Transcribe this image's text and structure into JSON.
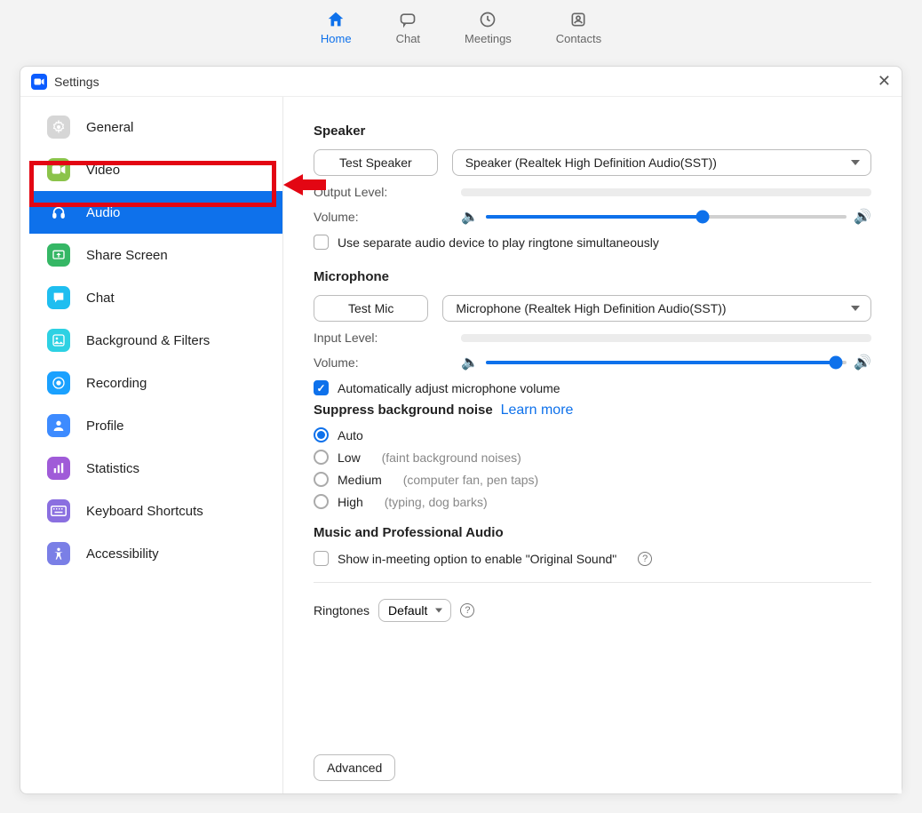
{
  "topnav": {
    "home": "Home",
    "chat": "Chat",
    "meetings": "Meetings",
    "contacts": "Contacts"
  },
  "window": {
    "title": "Settings"
  },
  "sidebar": {
    "items": [
      {
        "label": "General",
        "icon": "gear",
        "bg": "#d6d6d6"
      },
      {
        "label": "Video",
        "icon": "video",
        "bg": "#8bc34a"
      },
      {
        "label": "Audio",
        "icon": "headphones",
        "bg": "#0e71eb",
        "active": true
      },
      {
        "label": "Share Screen",
        "icon": "share",
        "bg": "#35b765"
      },
      {
        "label": "Chat",
        "icon": "chat",
        "bg": "#1fbef0"
      },
      {
        "label": "Background & Filters",
        "icon": "bg",
        "bg": "#2dd1e3"
      },
      {
        "label": "Recording",
        "icon": "rec",
        "bg": "#1aa1ff"
      },
      {
        "label": "Profile",
        "icon": "profile",
        "bg": "#3d8bff"
      },
      {
        "label": "Statistics",
        "icon": "stats",
        "bg": "#a05bd8"
      },
      {
        "label": "Keyboard Shortcuts",
        "icon": "kbd",
        "bg": "#8a6fe0"
      },
      {
        "label": "Accessibility",
        "icon": "a11y",
        "bg": "#7a7fe6"
      }
    ]
  },
  "audio": {
    "speaker_h": "Speaker",
    "test_speaker": "Test Speaker",
    "speaker_device": "Speaker (Realtek High Definition Audio(SST))",
    "output_level": "Output Level:",
    "volume": "Volume:",
    "speaker_vol_pct": 60,
    "separate_device": "Use separate audio device to play ringtone simultaneously",
    "mic_h": "Microphone",
    "test_mic": "Test Mic",
    "mic_device": "Microphone (Realtek High Definition Audio(SST))",
    "input_level": "Input Level:",
    "mic_vol_pct": 97,
    "auto_adjust": "Automatically adjust microphone volume",
    "suppress_h": "Suppress background noise",
    "learn_more": "Learn more",
    "options": [
      {
        "label": "Auto",
        "hint": "",
        "selected": true
      },
      {
        "label": "Low",
        "hint": "(faint background noises)"
      },
      {
        "label": "Medium",
        "hint": "(computer fan, pen taps)"
      },
      {
        "label": "High",
        "hint": "(typing, dog barks)"
      }
    ],
    "music_h": "Music and Professional Audio",
    "original_sound": "Show in-meeting option to enable \"Original Sound\"",
    "ringtones_lbl": "Ringtones",
    "ringtones_val": "Default",
    "advanced": "Advanced"
  }
}
